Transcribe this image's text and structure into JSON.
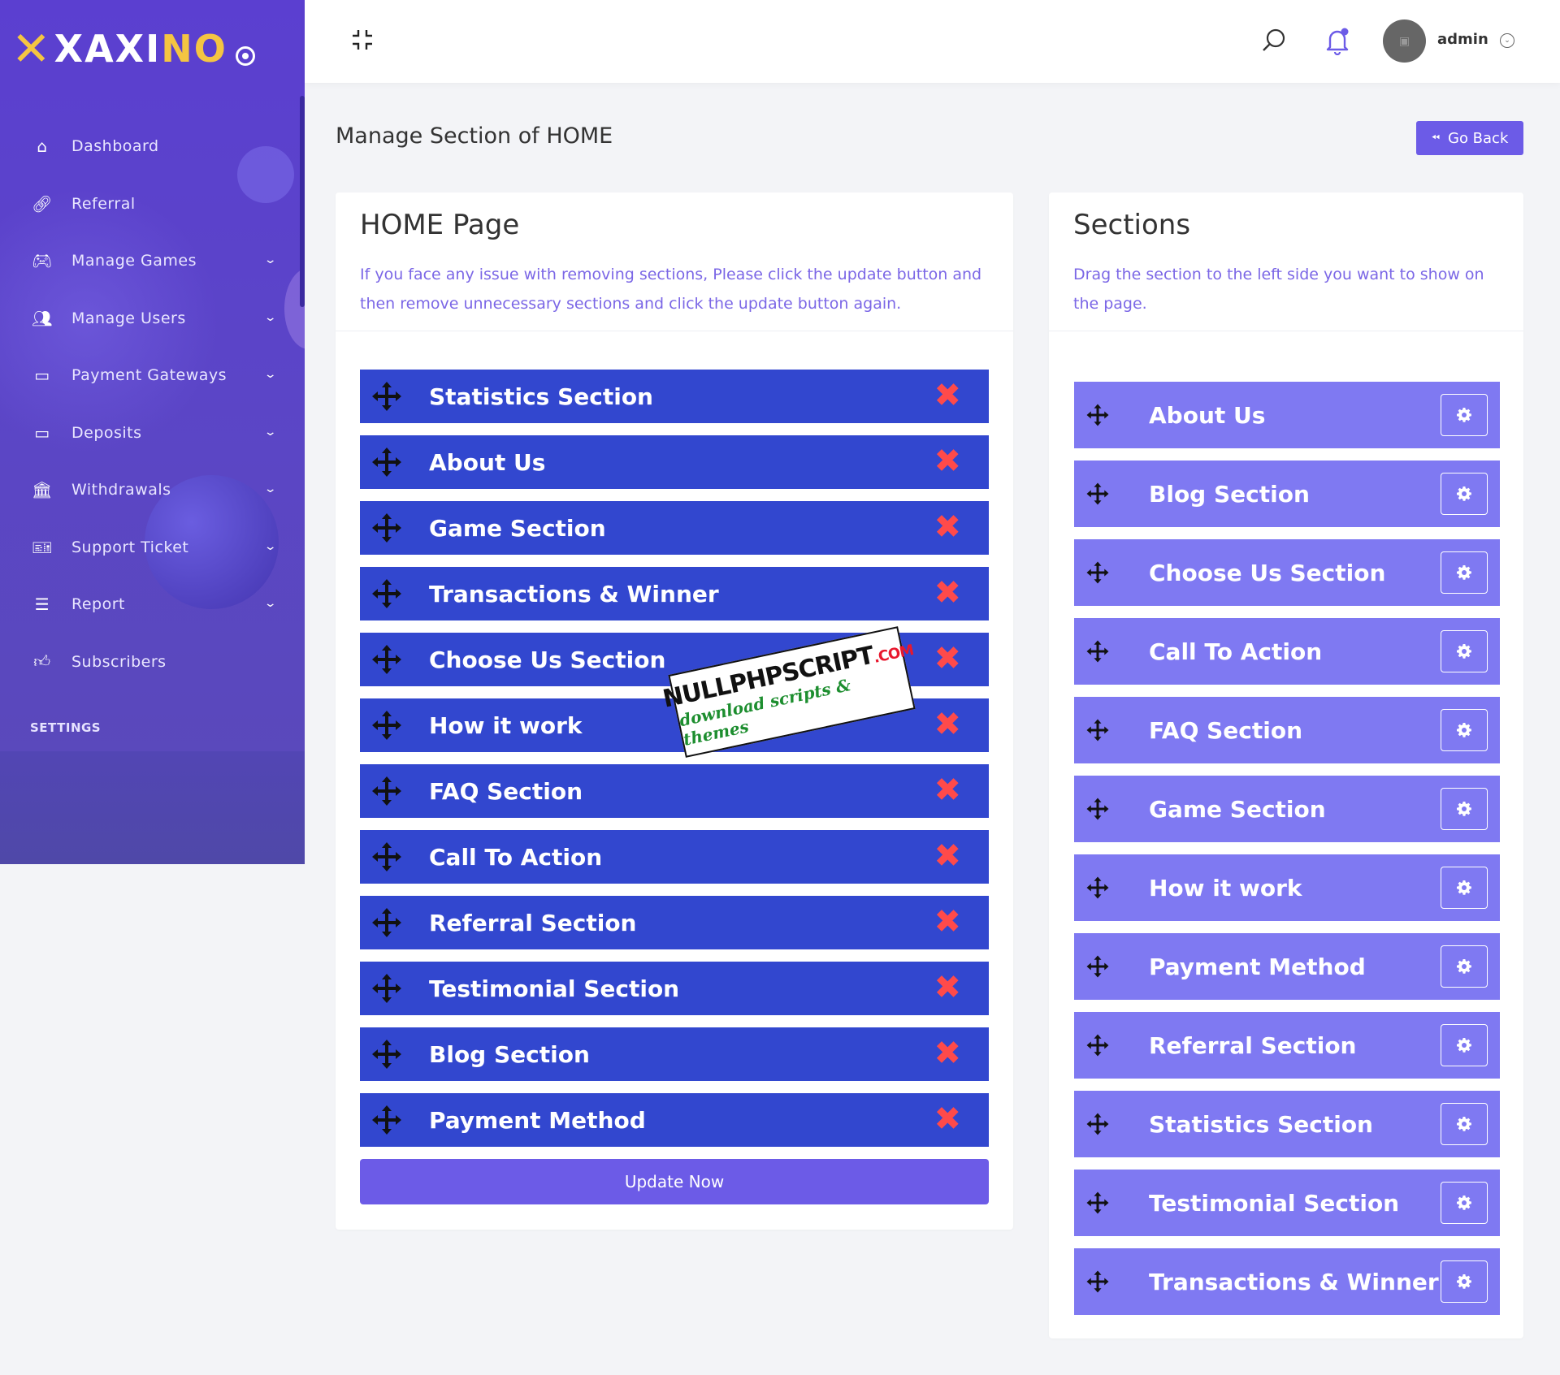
{
  "brand": {
    "logo_text_left": "XAXI",
    "logo_text_right": "NO"
  },
  "sidebar": {
    "items": [
      {
        "label": "Dashboard",
        "icon": "home-icon",
        "has_submenu": false
      },
      {
        "label": "Referral",
        "icon": "link-icon",
        "has_submenu": false
      },
      {
        "label": "Manage Games",
        "icon": "gamepad-icon",
        "has_submenu": true
      },
      {
        "label": "Manage Users",
        "icon": "users-icon",
        "has_submenu": true
      },
      {
        "label": "Payment Gateways",
        "icon": "credit-card-icon",
        "has_submenu": true
      },
      {
        "label": "Deposits",
        "icon": "wallet-icon",
        "has_submenu": true
      },
      {
        "label": "Withdrawals",
        "icon": "bank-icon",
        "has_submenu": true
      },
      {
        "label": "Support Ticket",
        "icon": "ticket-icon",
        "has_submenu": true
      },
      {
        "label": "Report",
        "icon": "list-icon",
        "has_submenu": true
      },
      {
        "label": "Subscribers",
        "icon": "thumbs-up-icon",
        "has_submenu": false
      }
    ],
    "settings_label": "SETTINGS"
  },
  "topbar": {
    "user_name": "admin"
  },
  "page": {
    "title": "Manage Section of HOME",
    "go_back_label": "Go Back"
  },
  "left_card": {
    "title": "HOME Page",
    "note": "If you face any issue with removing sections, Please click the update button and then remove unnecessary sections and click the update button again.",
    "sections": [
      "Statistics Section",
      "About Us",
      "Game Section",
      "Transactions & Winner",
      "Choose Us Section",
      "How it work",
      "FAQ Section",
      "Call To Action",
      "Referral Section",
      "Testimonial Section",
      "Blog Section",
      "Payment Method"
    ],
    "remove_symbol": "✖",
    "update_label": "Update Now"
  },
  "right_card": {
    "title": "Sections",
    "note": "Drag the section to the left side you want to show on the page.",
    "sections": [
      "About Us",
      "Blog Section",
      "Choose Us Section",
      "Call To Action",
      "FAQ Section",
      "Game Section",
      "How it work",
      "Payment Method",
      "Referral Section",
      "Statistics Section",
      "Testimonial Section",
      "Transactions & Winner"
    ]
  },
  "watermark": {
    "line1": "NULLPHPSCRIPT",
    "line1_suffix": ".COM",
    "line2": "download scripts & themes"
  },
  "colors": {
    "sidebar": "#5b3fd0",
    "primary_button": "#6c5be7",
    "active_section": "#3247cf",
    "available_section": "#7f79f2",
    "remove_icon": "#ff4a4a",
    "note_text": "#7b67e6"
  }
}
